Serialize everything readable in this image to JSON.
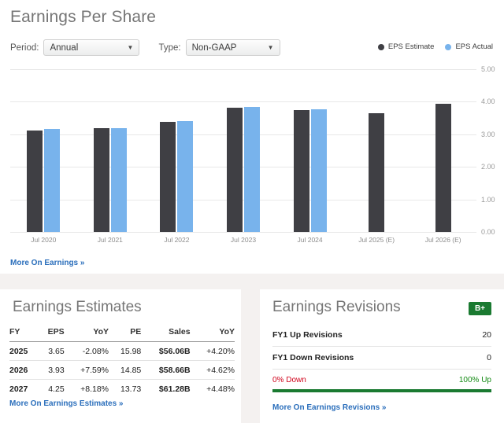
{
  "header": {
    "title": "Earnings Per Share",
    "more_link": "More On Earnings »"
  },
  "controls": {
    "period_label": "Period:",
    "period_value": "Annual",
    "type_label": "Type:",
    "type_value": "Non-GAAP",
    "caret_glyph": "▼"
  },
  "legend": [
    {
      "label": "EPS Estimate",
      "color": "#3f3f44"
    },
    {
      "label": "EPS Actual",
      "color": "#78b3ec"
    }
  ],
  "chart_data": {
    "type": "bar",
    "title": "Earnings Per Share",
    "xlabel": "",
    "ylabel": "",
    "ylim": [
      0,
      5
    ],
    "ytick_labels": [
      "0.00",
      "1.00",
      "2.00",
      "3.00",
      "4.00",
      "5.00"
    ],
    "ytick_values": [
      0,
      1,
      2,
      3,
      4,
      5
    ],
    "grid": true,
    "legend_position": "top-right",
    "categories": [
      "Jul 2020",
      "Jul 2021",
      "Jul 2022",
      "Jul 2023",
      "Jul 2024",
      "Jul 2025 (E)",
      "Jul 2026 (E)"
    ],
    "series": [
      {
        "name": "EPS Estimate",
        "color": "#3f3f44",
        "values": [
          3.12,
          3.19,
          3.39,
          3.82,
          3.74,
          3.65,
          3.93
        ]
      },
      {
        "name": "EPS Actual",
        "color": "#78b3ec",
        "values": [
          3.17,
          3.2,
          3.4,
          3.85,
          3.76,
          null,
          null
        ]
      }
    ]
  },
  "estimates_panel": {
    "title": "Earnings Estimates",
    "columns": [
      "FY",
      "EPS",
      "YoY",
      "PE",
      "Sales",
      "YoY"
    ],
    "rows": [
      {
        "fy": "2025",
        "eps": "3.65",
        "eps_yoy": "-2.08%",
        "eps_yoy_sign": "neg",
        "pe": "15.98",
        "sales": "$56.06B",
        "sales_yoy": "+4.20%",
        "sales_yoy_sign": "pos"
      },
      {
        "fy": "2026",
        "eps": "3.93",
        "eps_yoy": "+7.59%",
        "eps_yoy_sign": "pos",
        "pe": "14.85",
        "sales": "$58.66B",
        "sales_yoy": "+4.62%",
        "sales_yoy_sign": "pos"
      },
      {
        "fy": "2027",
        "eps": "4.25",
        "eps_yoy": "+8.18%",
        "eps_yoy_sign": "pos",
        "pe": "13.73",
        "sales": "$61.28B",
        "sales_yoy": "+4.48%",
        "sales_yoy_sign": "pos"
      }
    ],
    "more_link": "More On Earnings Estimates »"
  },
  "revisions_panel": {
    "title": "Earnings Revisions",
    "grade": "B+",
    "grade_color": "#1a7a31",
    "rows": [
      {
        "label": "FY1 Up Revisions",
        "value": "20"
      },
      {
        "label": "FY1 Down Revisions",
        "value": "0"
      }
    ],
    "down_label": "0% Down",
    "up_label": "100% Up",
    "up_percent": 100,
    "more_link": "More On Earnings Revisions »"
  }
}
